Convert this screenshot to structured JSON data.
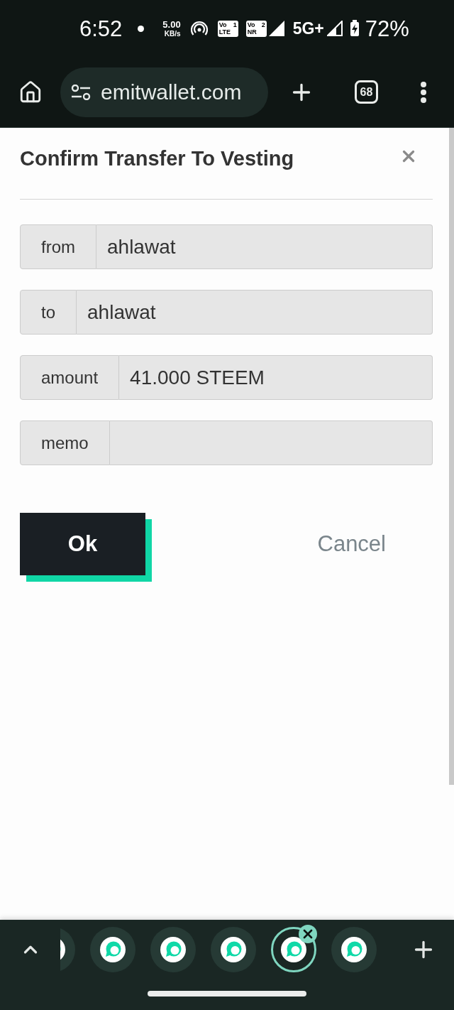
{
  "status_bar": {
    "time": "6:52",
    "speed_value": "5.00",
    "speed_unit": "KB/s",
    "sims": [
      {
        "type": "Vo",
        "slot": "1",
        "network": "LTE"
      },
      {
        "type": "Vo",
        "slot": "2",
        "network": "NR"
      }
    ],
    "network": "5G+",
    "battery": "72%"
  },
  "browser": {
    "url": "emitwallet.com",
    "tab_count": "68"
  },
  "dialog": {
    "title": "Confirm Transfer To Vesting",
    "fields": [
      {
        "label": "from",
        "value": "ahlawat"
      },
      {
        "label": "to",
        "value": "ahlawat"
      },
      {
        "label": "amount",
        "value": "41.000 STEEM"
      },
      {
        "label": "memo"
      }
    ],
    "buttons": [
      {
        "label": "Ok",
        "kind": "primary"
      },
      {
        "label": "Cancel",
        "kind": "secondary"
      }
    ]
  },
  "tab_strip": {
    "tabs": [
      {
        "selected": false
      },
      {
        "selected": false
      },
      {
        "selected": false
      },
      {
        "selected": false
      },
      {
        "selected": true
      },
      {
        "selected": false
      }
    ]
  }
}
